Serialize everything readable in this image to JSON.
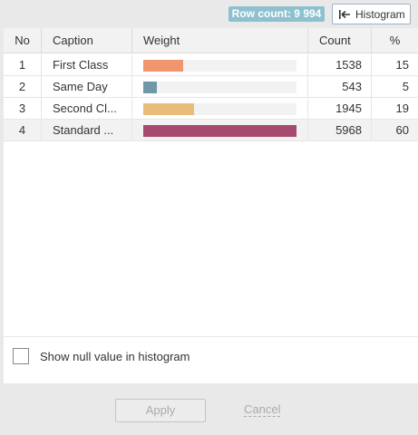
{
  "toolbar": {
    "row_count_label": "Row count: 9 994",
    "histogram_button_label": "Histogram"
  },
  "table": {
    "headers": {
      "no": "No",
      "caption": "Caption",
      "weight": "Weight",
      "count": "Count",
      "percent": "%"
    },
    "rows": [
      {
        "no": "1",
        "caption": "First Class",
        "count": "1538",
        "percent": "15",
        "weight_fraction": 0.26,
        "color": "#f0956e"
      },
      {
        "no": "2",
        "caption": "Same Day",
        "count": "543",
        "percent": "5",
        "weight_fraction": 0.09,
        "color": "#6f97a8"
      },
      {
        "no": "3",
        "caption": "Second Cl...",
        "count": "1945",
        "percent": "19",
        "weight_fraction": 0.33,
        "color": "#e8bd7a"
      },
      {
        "no": "4",
        "caption": "Standard ...",
        "count": "5968",
        "percent": "60",
        "weight_fraction": 1.0,
        "color": "#a64a6f"
      }
    ]
  },
  "options": {
    "show_null_label": "Show null value in histogram",
    "show_null_checked": false
  },
  "actions": {
    "apply_label": "Apply",
    "cancel_label": "Cancel"
  },
  "colors": {
    "row_count_badge": "#8ec1cf"
  }
}
